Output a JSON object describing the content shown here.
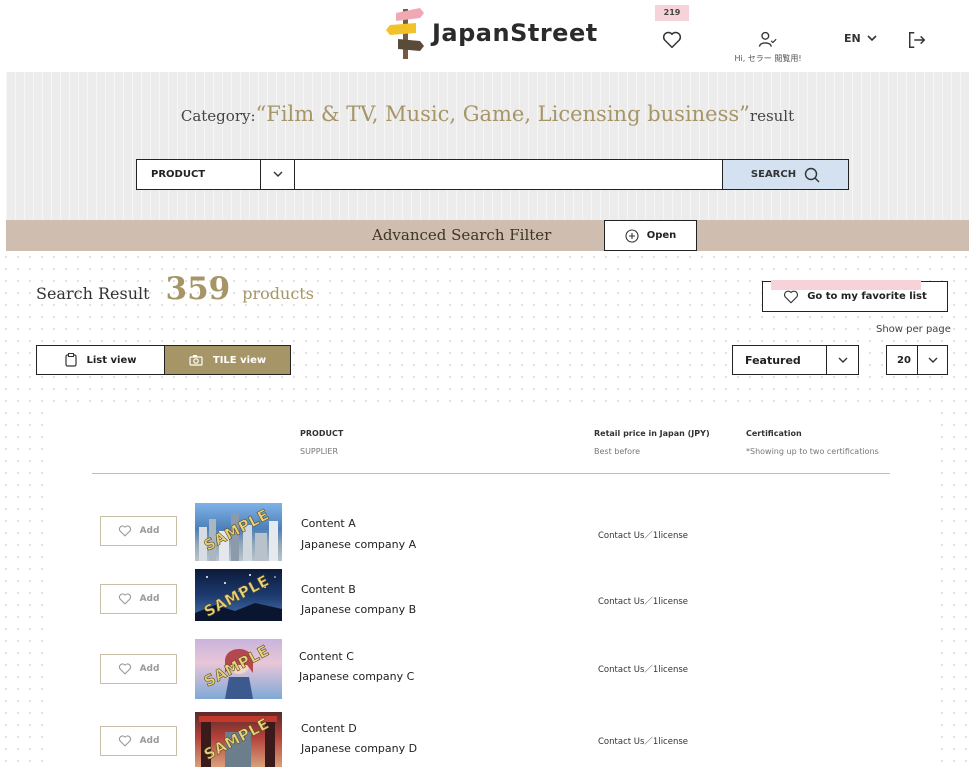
{
  "brand": {
    "name": "JapanStreet"
  },
  "header": {
    "favorites_count": "219",
    "user_greeting": "Hi, セラー 閲覧用!",
    "language": "EN"
  },
  "category": {
    "prefix": "Category:",
    "name": "“Film & TV, Music, Game, Licensing business”",
    "suffix": "result"
  },
  "search": {
    "type_selected": "PRODUCT",
    "query": "",
    "button_label": "SEARCH"
  },
  "advanced_filter": {
    "title": "Advanced Search Filter",
    "open_label": "Open"
  },
  "results": {
    "label": "Search Result",
    "count": "359",
    "unit": "products",
    "favorite_list_label": "Go to my favorite list",
    "show_per_page_label": "Show per page",
    "sort_selected": "Featured",
    "per_page_selected": "20",
    "list_view_label": "List view",
    "tile_view_label": "TILE view"
  },
  "table": {
    "headers": {
      "product": "PRODUCT",
      "supplier": "SUPPLIER",
      "price": "Retail price in Japan (JPY)",
      "best_before": "Best before",
      "certification": "Certification",
      "certification_note": "*Showing up to two certifications"
    },
    "rows": [
      {
        "add_label": "Add",
        "stamp": "SAMPLE",
        "name": "Content A",
        "supplier": "Japanese company A",
        "price": "Contact Us／1license"
      },
      {
        "add_label": "Add",
        "stamp": "SAMPLE",
        "name": "Content B",
        "supplier": "Japanese company B",
        "price": "Contact Us／1license"
      },
      {
        "add_label": "Add",
        "stamp": "SAMPLE",
        "name": "Content C",
        "supplier": "Japanese company C",
        "price": "Contact Us／1license"
      },
      {
        "add_label": "Add",
        "stamp": "SAMPLE",
        "name": "Content D",
        "supplier": "Japanese company D",
        "price": "Contact Us／1license"
      }
    ]
  },
  "colors": {
    "accent_gold": "#a69567",
    "filter_bar": "#cfbeaf",
    "search_button": "#d4e1f0",
    "favorite_highlight": "#f6d3d8"
  },
  "icons": {
    "logo": "signpost-icon",
    "favorites": "heart-icon",
    "user": "user-check-icon",
    "language": "chevron-down-icon",
    "logout": "logout-icon",
    "search": "search-icon",
    "open_filter": "plus-circle-icon",
    "list_view": "clipboard-icon",
    "tile_view": "camera-icon",
    "add": "heart-icon"
  }
}
